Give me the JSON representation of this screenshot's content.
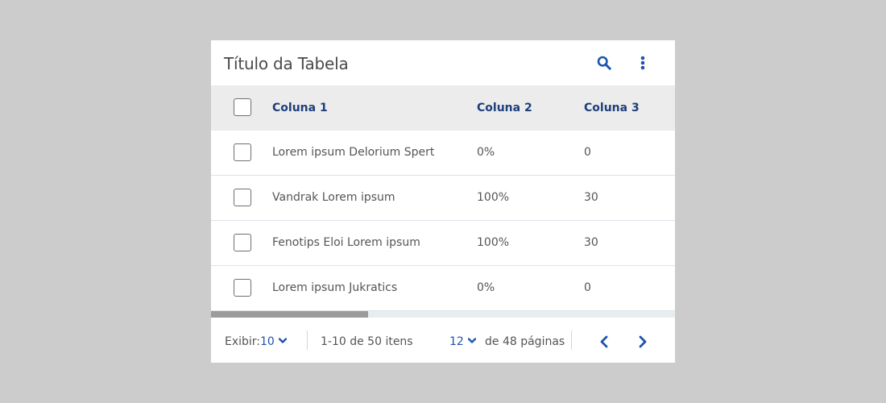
{
  "table": {
    "title": "Título da Tabela",
    "columns": [
      "Coluna 1",
      "Coluna 2",
      "Coluna 3"
    ],
    "rows": [
      [
        "Lorem ipsum Delorium Spert",
        "0%",
        "0"
      ],
      [
        "Vandrak Lorem ipsum",
        "100%",
        "30"
      ],
      [
        "Fenotips Eloi Lorem ipsum",
        "100%",
        "30"
      ],
      [
        "Lorem ipsum Jukratics",
        "0%",
        "0"
      ]
    ]
  },
  "footer": {
    "show_label": "Exibir:",
    "show_value": "10",
    "range_text": "1-10 de 50 itens",
    "page_value": "12",
    "pages_text": "de 48 páginas"
  },
  "colors": {
    "accent": "#1e54b0",
    "header_text": "#1d3f7a",
    "background": "#cccccc"
  },
  "icons": [
    "search-icon",
    "more-vertical-icon",
    "chevron-down-icon",
    "chevron-left-icon",
    "chevron-right-icon"
  ]
}
